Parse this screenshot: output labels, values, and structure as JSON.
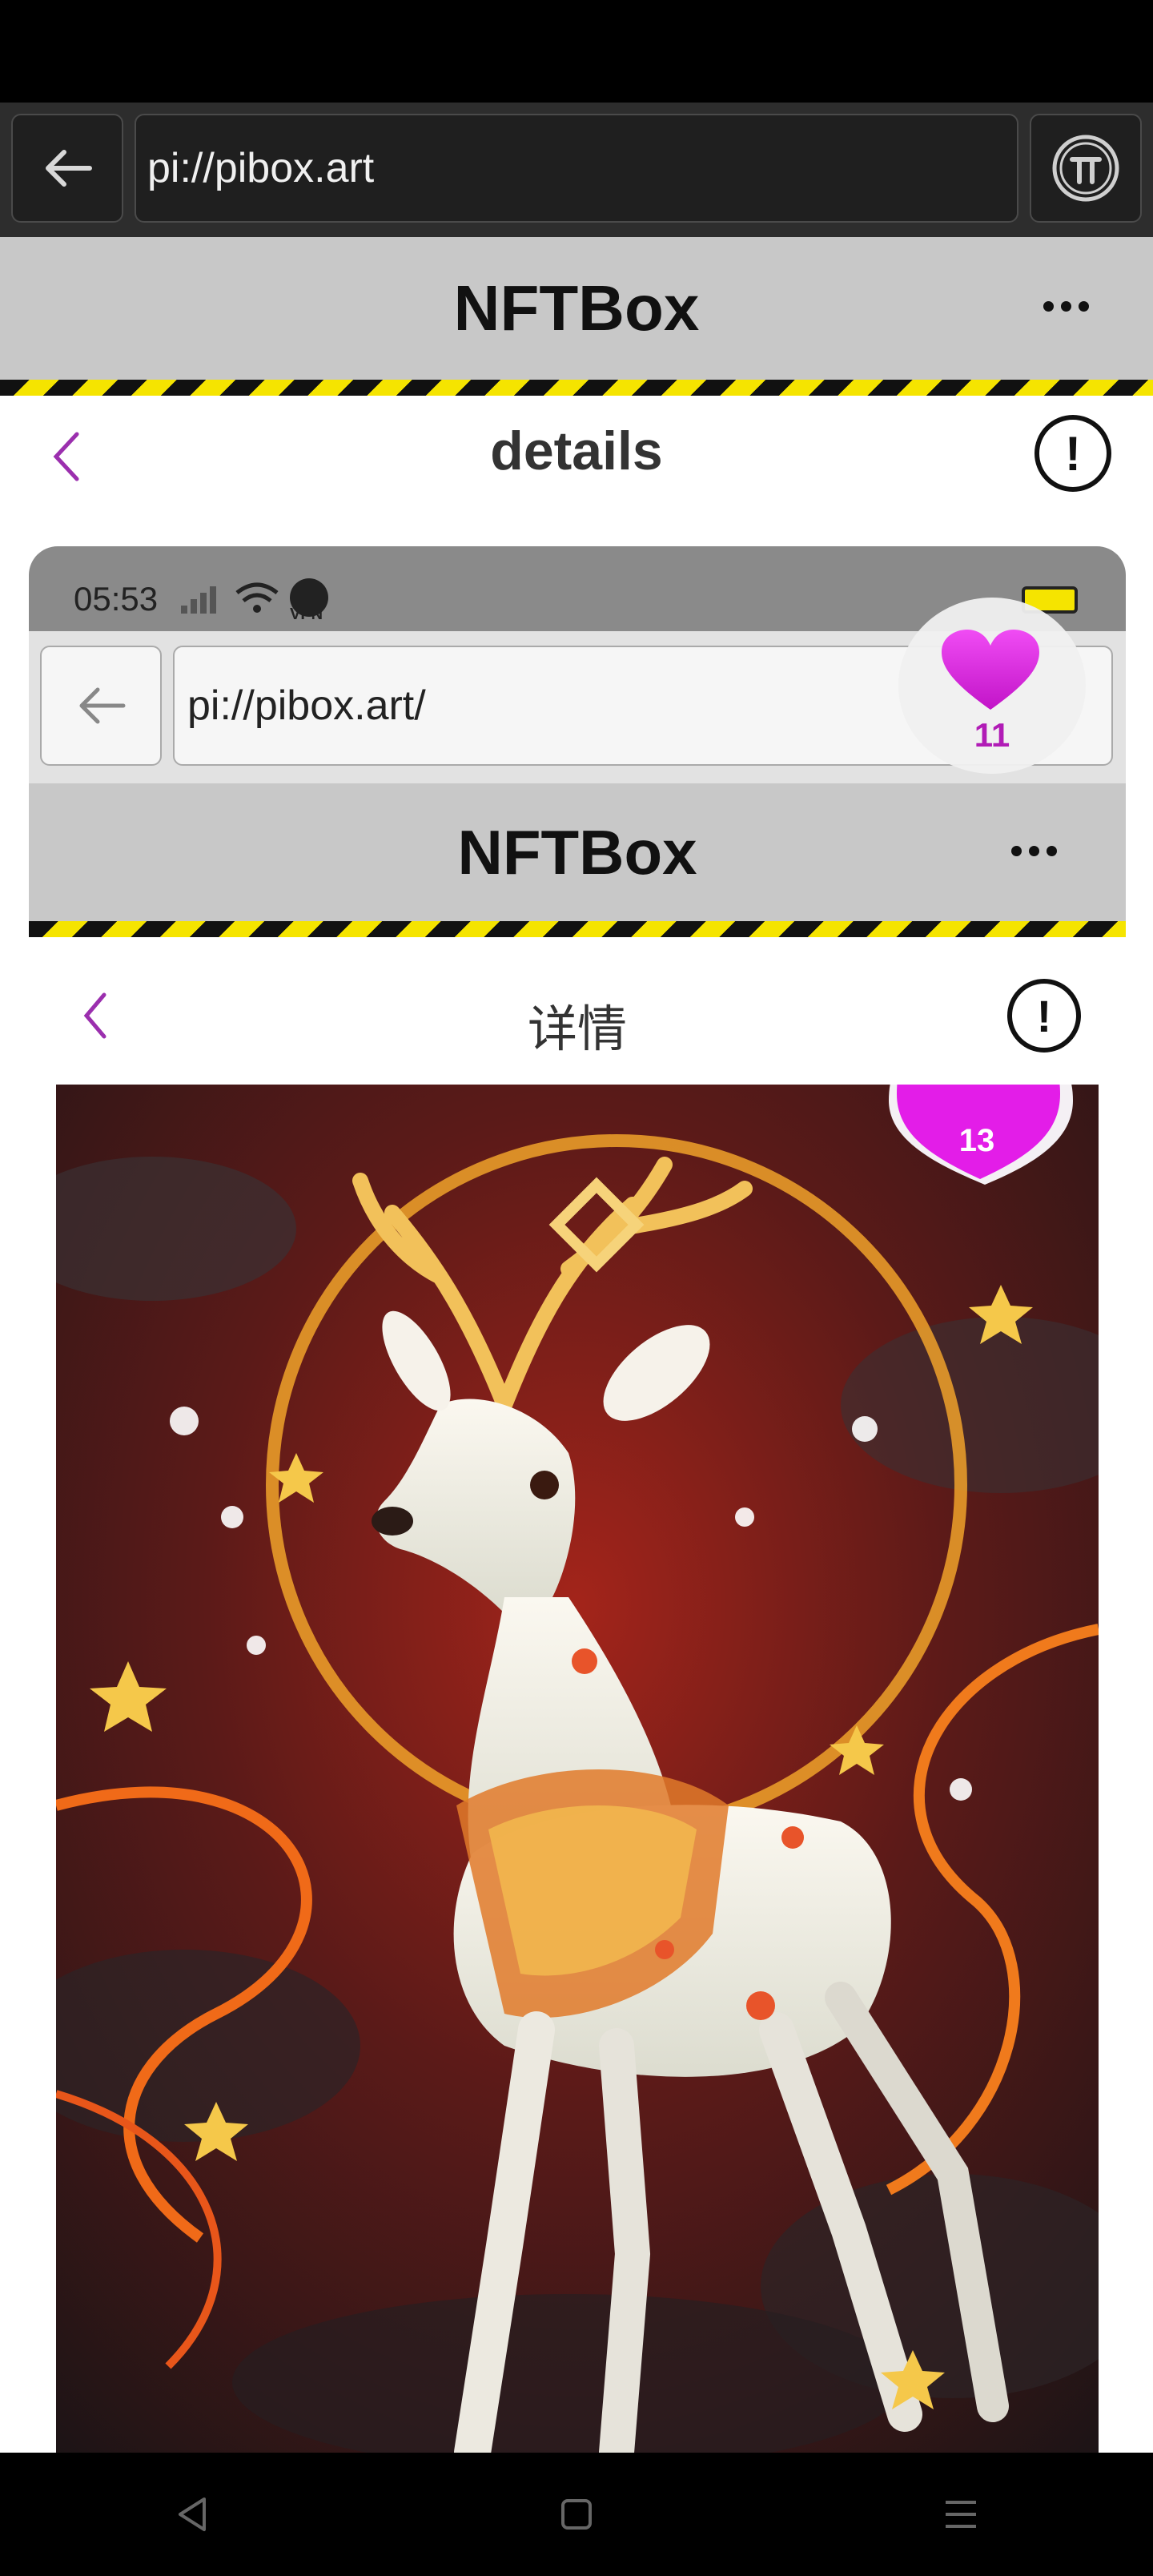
{
  "browser": {
    "url": "pi://pibox.art"
  },
  "app": {
    "title": "NFTBox",
    "page_title": "details"
  },
  "embedded": {
    "status_time": "05:53",
    "status_vpn": "VPN",
    "url": "pi://pibox.art/",
    "app_title": "NFTBox",
    "page_title": "详情",
    "like_count": "11",
    "art_like_count": "13"
  },
  "colors": {
    "accent": "#9b2fae",
    "like": "#e31de8",
    "hazard_yellow": "#f5e400",
    "header_gray": "#c8c8c8"
  },
  "icons": [
    "back-arrow-icon",
    "pi-logo-icon",
    "more-dots-icon",
    "chevron-left-icon",
    "info-icon",
    "heart-icon",
    "wifi-icon",
    "signal-icon",
    "battery-icon",
    "nav-back-icon",
    "nav-home-icon",
    "nav-menu-icon"
  ]
}
